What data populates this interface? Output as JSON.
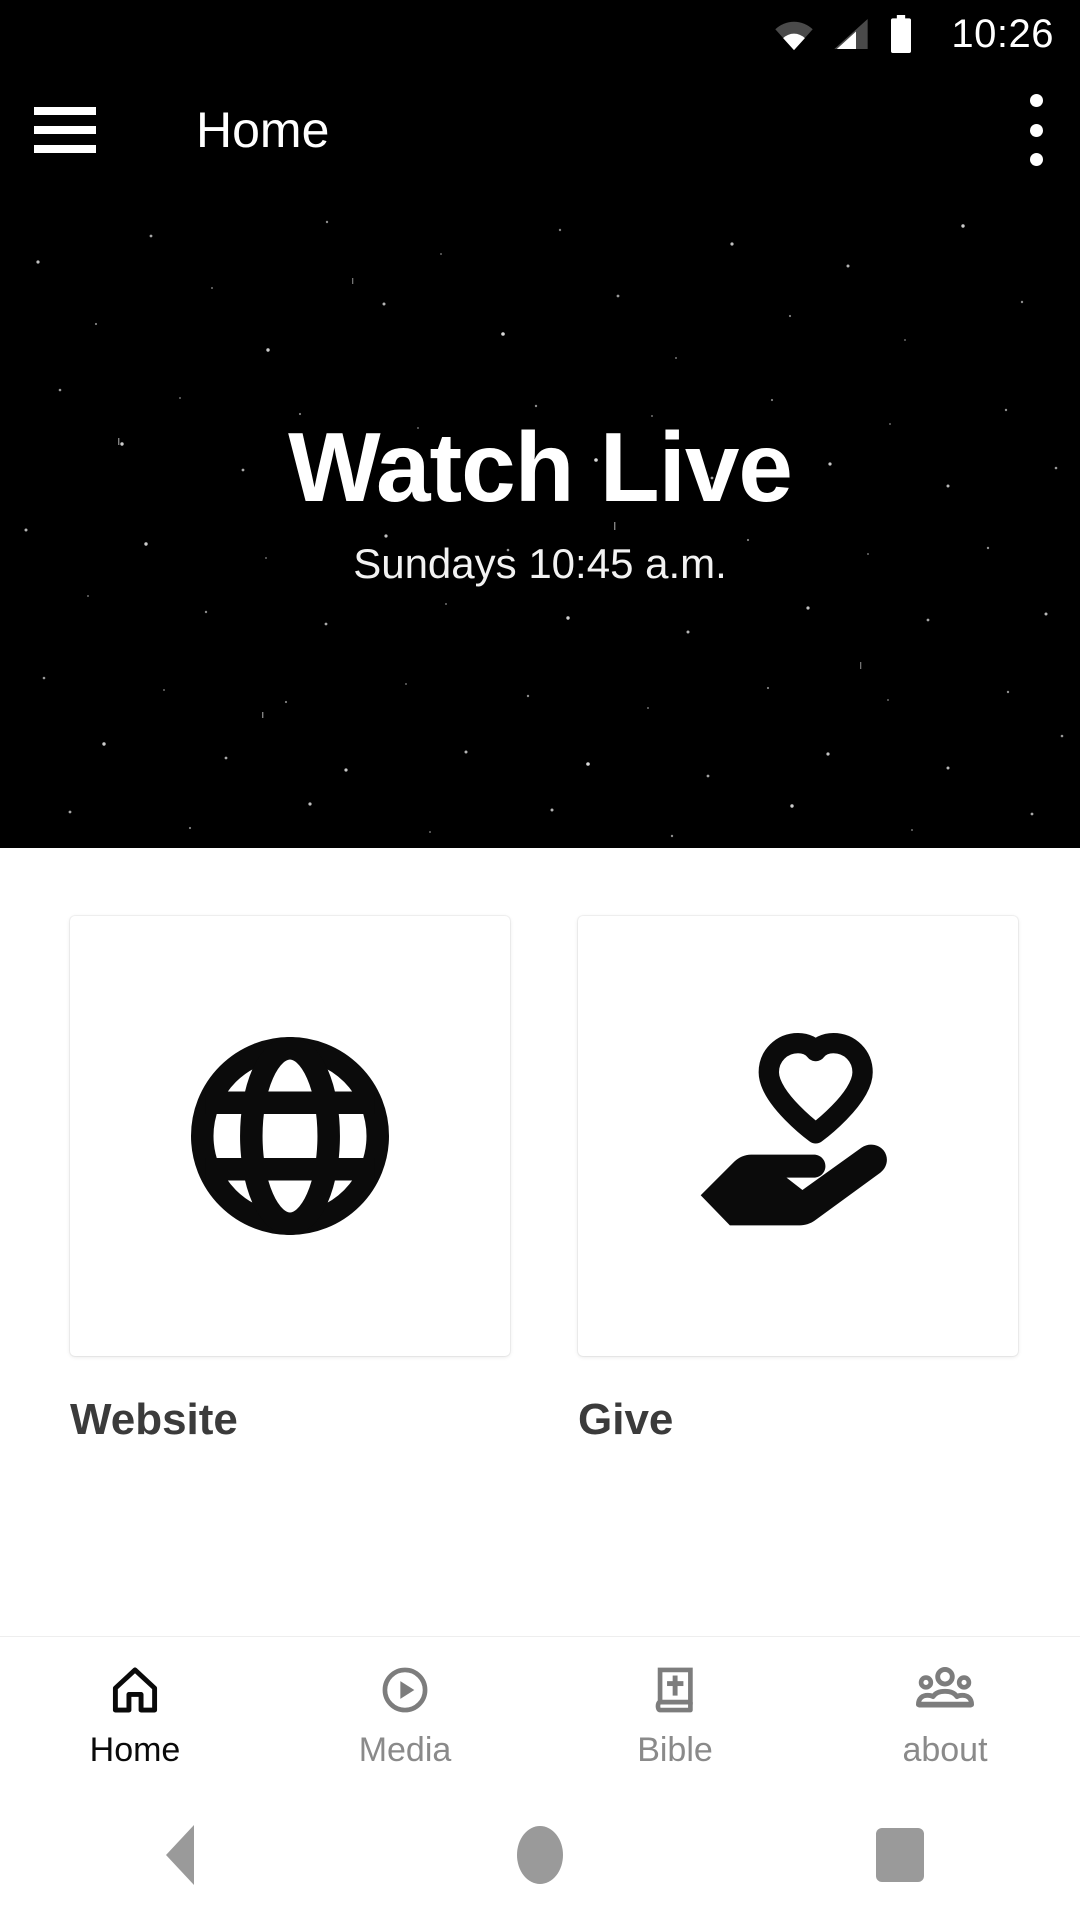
{
  "status_bar": {
    "time": "10:26",
    "icons": [
      "wifi-icon",
      "cellular-signal-icon",
      "battery-icon"
    ],
    "background": "#000000"
  },
  "app_bar": {
    "menu_icon": "hamburger-menu-icon",
    "title": "Home",
    "overflow_icon": "more-vertical-icon",
    "background": "#000000",
    "text_color": "#ffffff"
  },
  "hero": {
    "title": "Watch Live",
    "subtitle": "Sundays 10:45 a.m.",
    "background": "#000000",
    "style": "starfield-night-sky"
  },
  "tiles": [
    {
      "label": "Website",
      "icon": "globe-icon"
    },
    {
      "label": "Give",
      "icon": "heart-in-hand-icon"
    }
  ],
  "tab_bar": {
    "active_index": 0,
    "active_color": "#0a0a0a",
    "inactive_color": "#8a8a8a",
    "tabs": [
      {
        "label": "Home",
        "icon": "house-icon"
      },
      {
        "label": "Media",
        "icon": "play-circle-icon"
      },
      {
        "label": "Bible",
        "icon": "book-cross-icon"
      },
      {
        "label": "about",
        "icon": "people-group-icon"
      }
    ]
  },
  "system_nav": {
    "buttons": [
      {
        "name": "back",
        "icon": "triangle-back-icon"
      },
      {
        "name": "home",
        "icon": "circle-home-icon"
      },
      {
        "name": "recents",
        "icon": "square-recents-icon"
      }
    ],
    "color": "#9a9a9a"
  }
}
